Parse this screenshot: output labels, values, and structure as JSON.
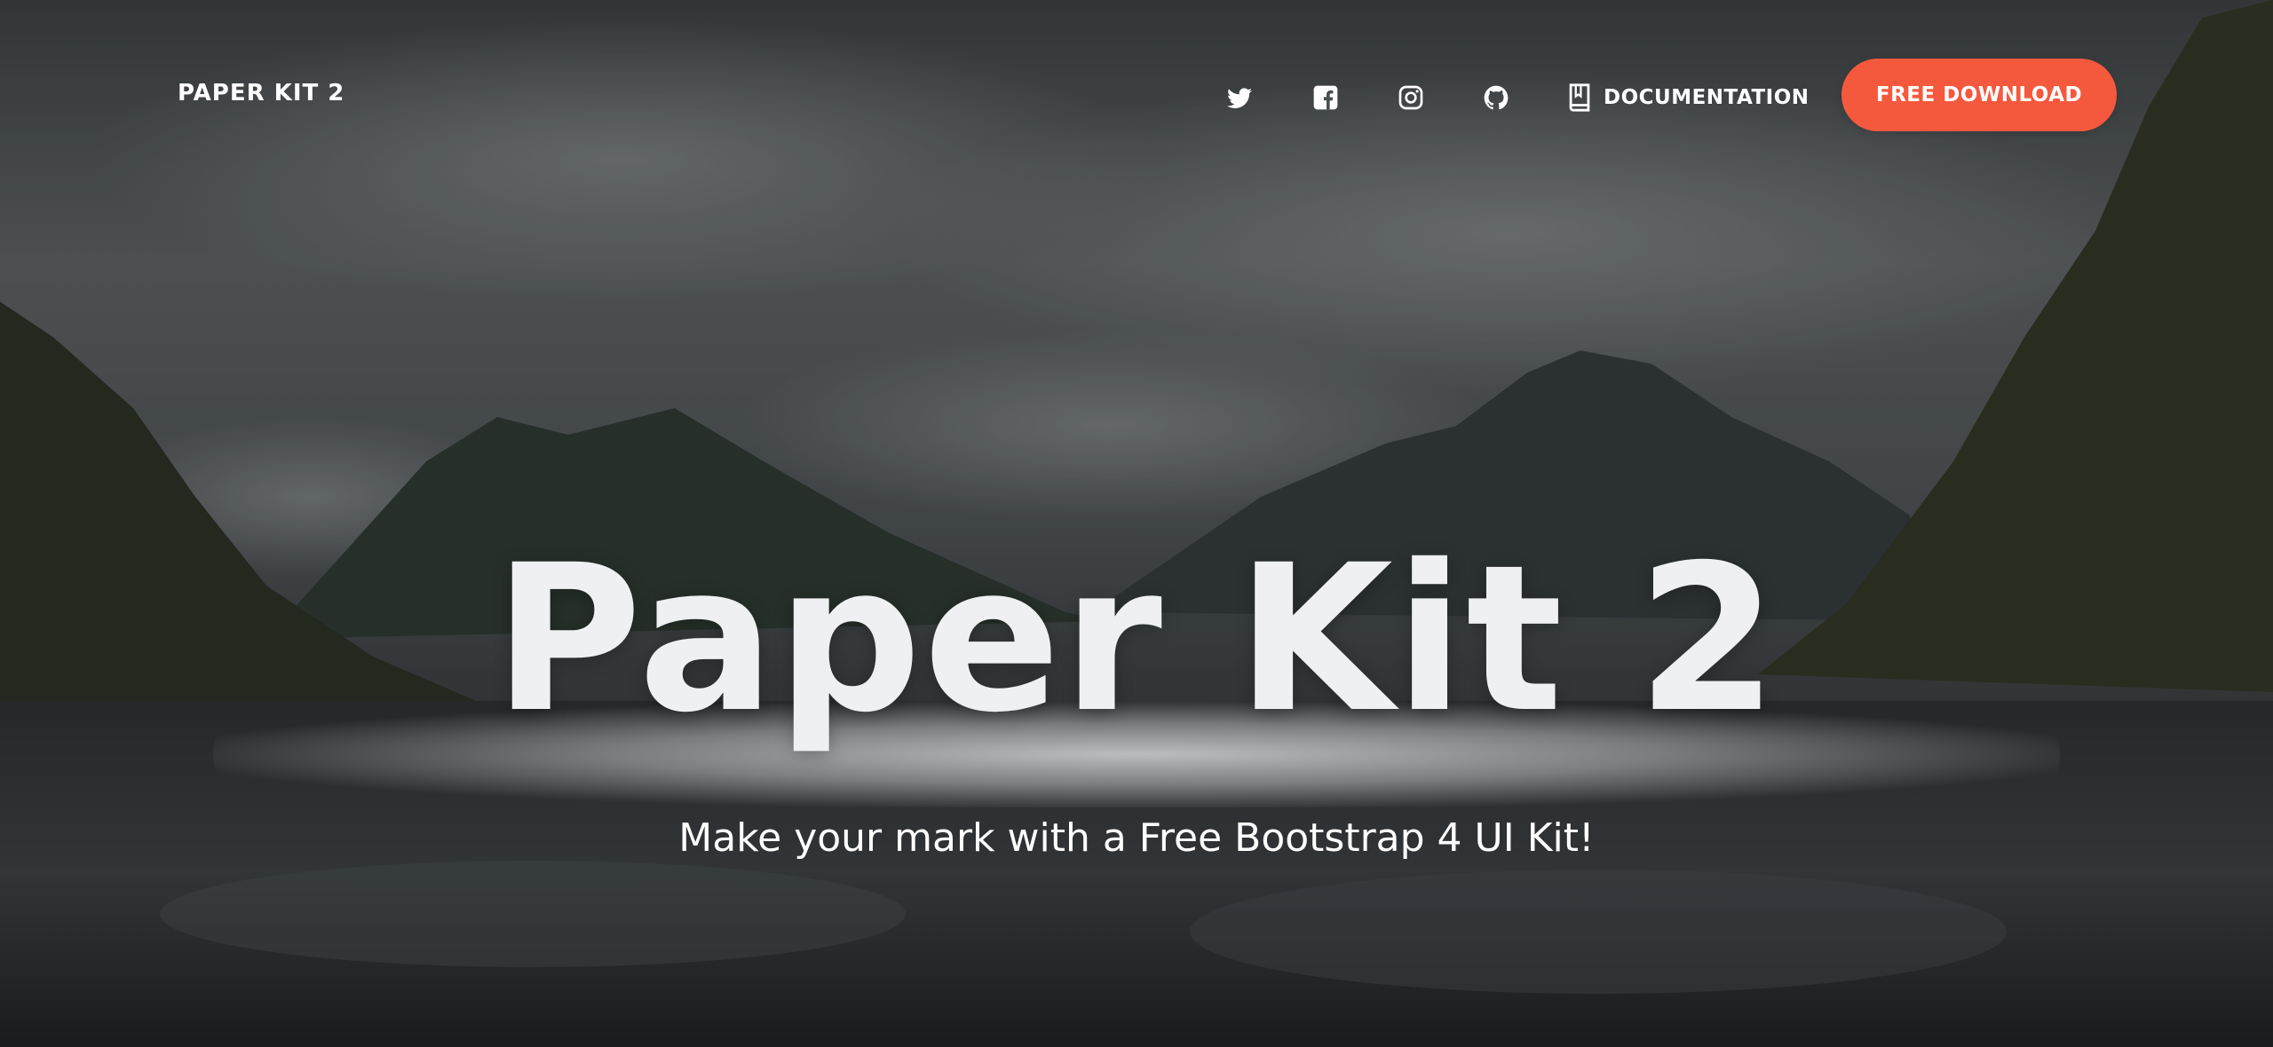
{
  "navbar": {
    "brand": "PAPER KIT 2",
    "social_icons": [
      "twitter-icon",
      "facebook-icon",
      "instagram-icon",
      "github-icon"
    ],
    "documentation_label": "DOCUMENTATION",
    "documentation_icon": "book-icon",
    "download_label": "FREE DOWNLOAD"
  },
  "hero": {
    "title": "Paper Kit 2",
    "subtitle": "Make your mark with a Free Bootstrap 4 UI Kit!"
  },
  "colors": {
    "accent": "#f5593d",
    "text": "#ffffff",
    "overlay": "#3f4446"
  }
}
